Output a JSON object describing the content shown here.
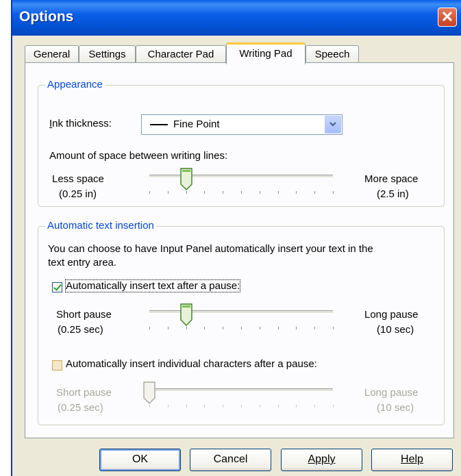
{
  "window": {
    "title": "Options"
  },
  "tabs": [
    "General",
    "Settings",
    "Character Pad",
    "Writing Pad",
    "Speech"
  ],
  "active_tab": "Writing Pad",
  "appearance": {
    "legend": "Appearance",
    "ink_label": "Ink thickness:",
    "ink_value": "Fine Point",
    "spacing_label": "Amount of space between writing lines:",
    "less_label": "Less space",
    "less_value": "(0.25 in)",
    "more_label": "More space",
    "more_value": "(2.5 in)",
    "slider_fraction": 0.2
  },
  "insertion": {
    "legend": "Automatic text insertion",
    "description_line1": "You can choose to have Input Panel automatically insert your text in the",
    "description_line2": "text entry area.",
    "checkbox1_label": "Automatically insert text after a pause:",
    "checkbox1_checked": true,
    "short_label": "Short pause",
    "short_value": "(0.25 sec)",
    "long_label": "Long pause",
    "long_value": "(10 sec)",
    "slider1_fraction": 0.2,
    "checkbox2_label": "Automatically insert individual characters after a pause:",
    "checkbox2_checked": false,
    "short2_label": "Short pause",
    "short2_value": "(0.25 sec)",
    "long2_label": "Long pause",
    "long2_value": "(10 sec)",
    "slider2_fraction": 0.0
  },
  "buttons": {
    "ok": "OK",
    "cancel": "Cancel",
    "apply": "Apply",
    "help": "Help"
  }
}
